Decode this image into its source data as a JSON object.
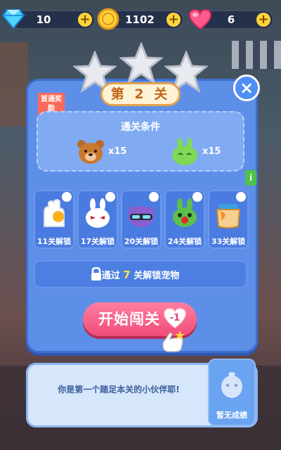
{
  "resources": {
    "gems": "10",
    "coins": "1102",
    "hearts": "6",
    "plus": "+"
  },
  "dialog": {
    "level_label": "第 2 关",
    "close": "×",
    "first_pass_ribbon": "首通奖励",
    "condition_title": "通关条件",
    "conditions": [
      {
        "icon": "bear-head-icon",
        "count": "x15"
      },
      {
        "icon": "green-bunny-icon",
        "count": "x15"
      }
    ],
    "info": "i",
    "pets": [
      {
        "icon": "glove-pet-icon",
        "label": "11关解锁"
      },
      {
        "icon": "white-bunny-pet-icon",
        "label": "17关解锁"
      },
      {
        "icon": "purple-cat-pet-icon",
        "label": "20关解锁"
      },
      {
        "icon": "green-bunny-clown-pet-icon",
        "label": "24关解锁"
      },
      {
        "icon": "honey-jar-pet-icon",
        "label": "33关解锁"
      }
    ],
    "unlock_prefix": "通过",
    "unlock_num": "7",
    "unlock_suffix": "关解锁宠物",
    "start_label": "开始闯关",
    "start_cost": "-1"
  },
  "bottom": {
    "message": "你是第一个踏足本关的小伙伴耶!",
    "record_label": "暂无成绩"
  },
  "colors": {
    "dialog_blue": "#5d8fe8",
    "start_pink": "#f04c7a",
    "coin_gold": "#ffd43a"
  }
}
